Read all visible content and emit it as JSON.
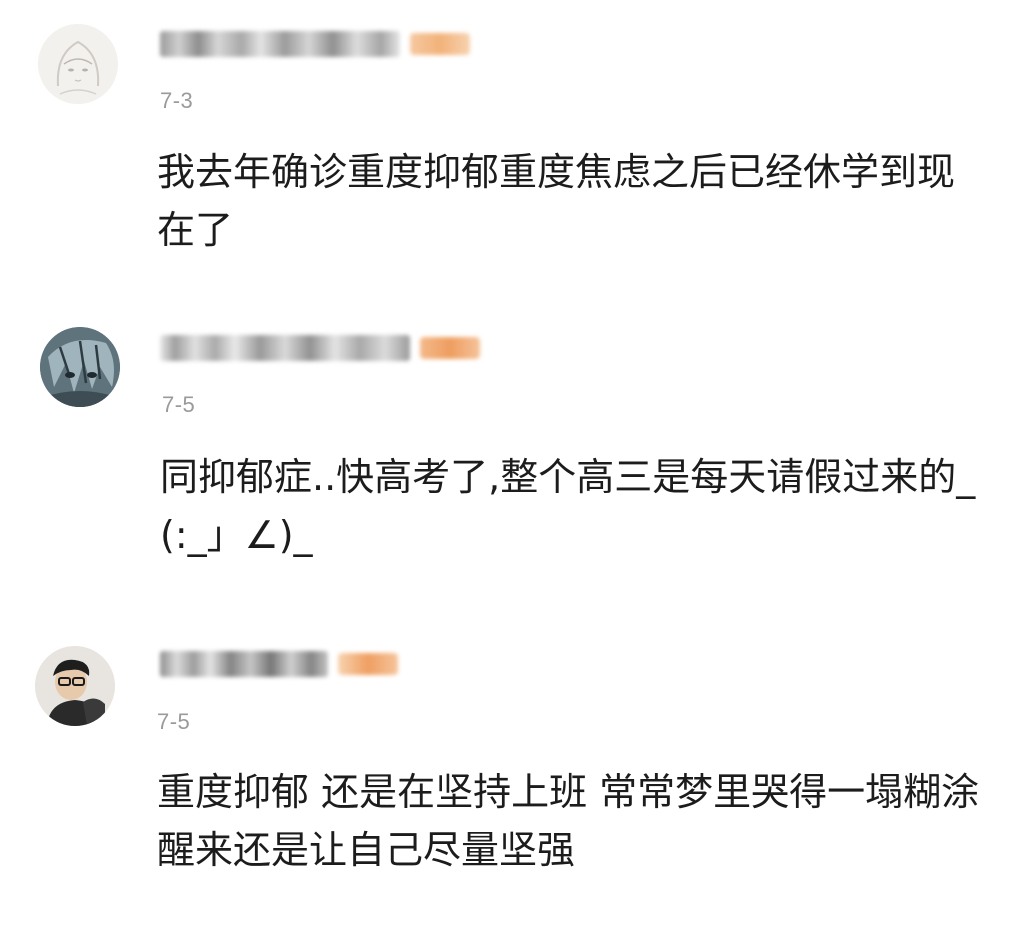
{
  "comments": [
    {
      "avatar_icon": "anime-girl-sketch-avatar",
      "date": "7-3",
      "text": "我去年确诊重度抑郁重度焦虑之后已经休学到现在了"
    },
    {
      "avatar_icon": "anime-character-avatar",
      "date": "7-5",
      "text": "同抑郁症..快高考了,整个高三是每天请假过来的_(:_」∠)_"
    },
    {
      "avatar_icon": "person-photo-avatar",
      "date": "7-5",
      "text": "重度抑郁 还是在坚持上班 常常梦里哭得一塌糊涂 醒来还是让自己尽量坚强"
    }
  ],
  "colors": {
    "date": "#9a9a9a",
    "text": "#1c1c1c",
    "badge": "#f2b27a"
  }
}
